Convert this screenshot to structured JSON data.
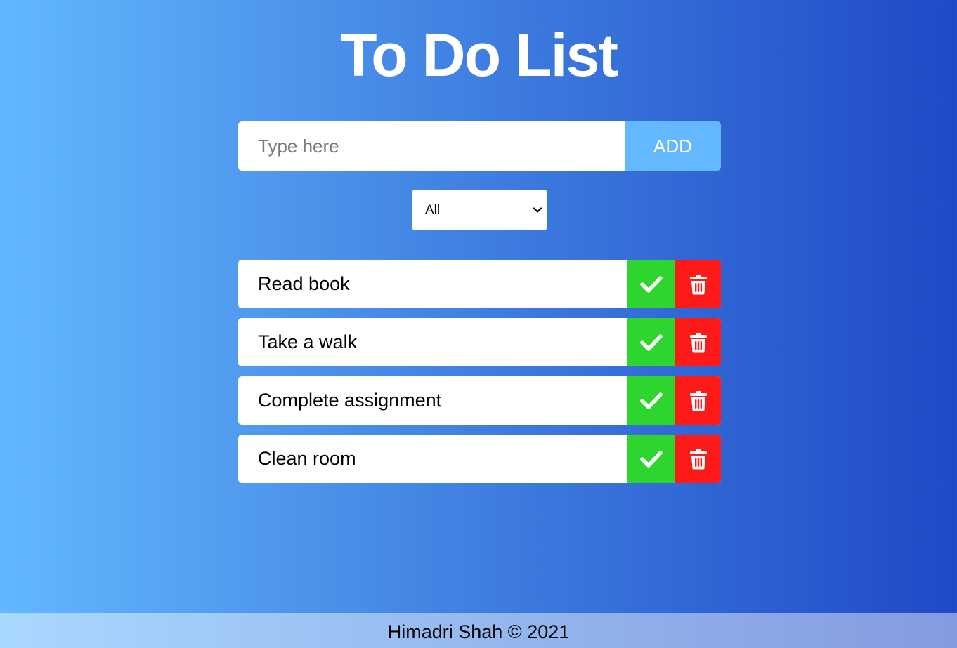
{
  "title": "To Do List",
  "add_form": {
    "input_placeholder": "Type here",
    "input_value": "",
    "add_label": "ADD"
  },
  "filter": {
    "selected": "All"
  },
  "todos": [
    {
      "text": "Read book"
    },
    {
      "text": "Take a walk"
    },
    {
      "text": "Complete assignment"
    },
    {
      "text": "Clean room"
    }
  ],
  "icons": {
    "complete": "check-icon",
    "delete": "trash-icon",
    "dropdown": "chevron-down-icon"
  },
  "colors": {
    "complete": "#2ed52e",
    "delete": "#ff1a1a",
    "accent": "#63b8ff"
  },
  "footer": {
    "text": "Himadri Shah © 2021"
  }
}
